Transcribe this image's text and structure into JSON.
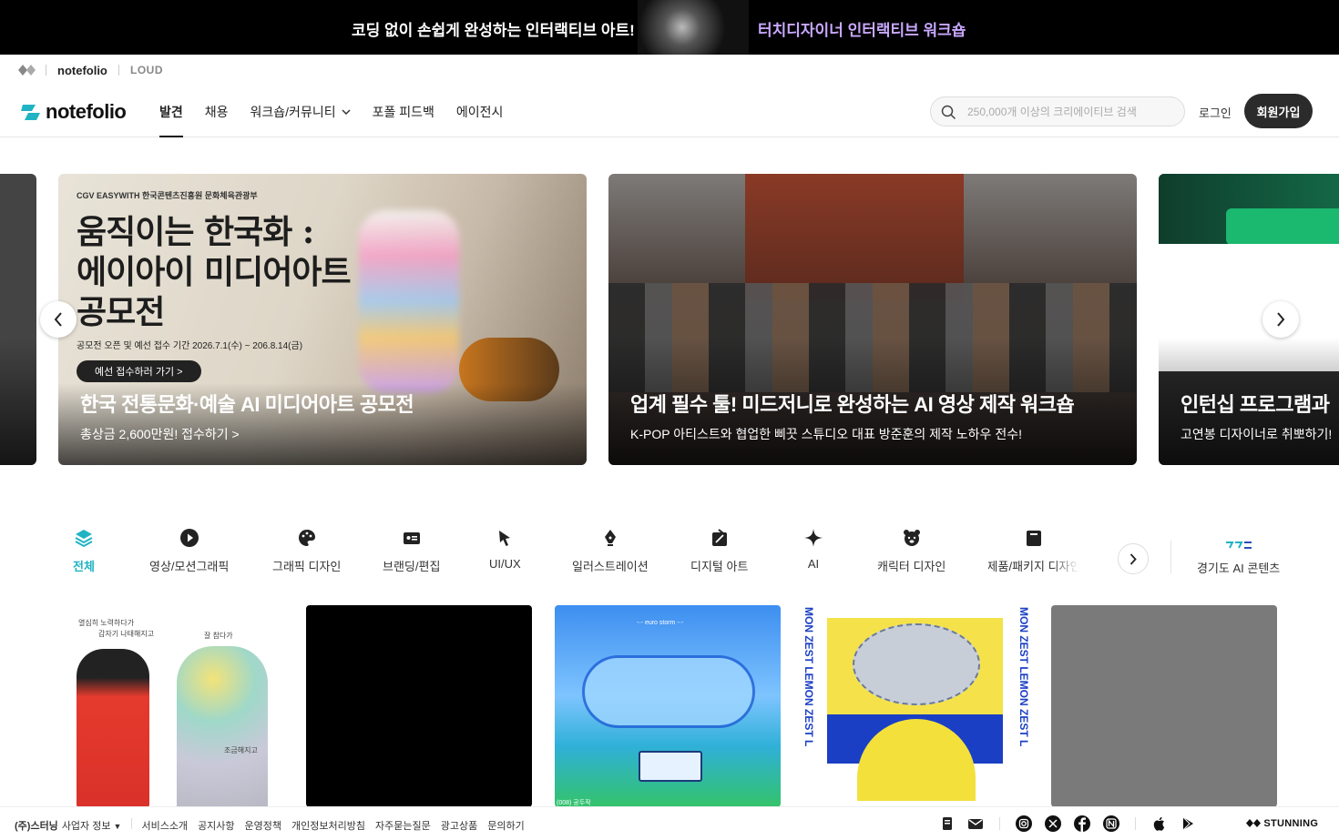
{
  "banner": {
    "left_text": "코딩 없이 손쉽게 완성하는 인터랙티브 아트!",
    "right_text": "터치디자이너 인터랙티브 워크숍",
    "right_color": "#c9a8ff"
  },
  "subnav": {
    "notefolio": "notefolio",
    "loud": "LOUD"
  },
  "header": {
    "brand": "notefolio",
    "brand_color": "#1fb3c4",
    "nav": [
      "발견",
      "채용",
      "워크숍/커뮤니티",
      "포폴 피드백",
      "에이전시"
    ],
    "active_nav": "발견",
    "search_placeholder": "250,000개 이상의 크리에이티브 검색",
    "login": "로그인",
    "signup": "회원가입"
  },
  "carousel": {
    "slides": [
      {
        "poster_brand": "CGV  EASYWITH  한국콘텐츠진흥원  문화체육관광부",
        "poster_title_1": "움직이는 한국화 :",
        "poster_title_2": "에이아이 미디어아트",
        "poster_title_3": "공모전",
        "poster_period": "공모전 오픈 및 예선 접수 기간   2026.7.1(수) ~ 206.8.14(금)",
        "poster_cta": "예선 접수하러 가기 >",
        "title": "한국 전통문화·예술 AI 미디어아트 공모전",
        "subtitle": "총상금 2,600만원! 접수하기 >"
      },
      {
        "title": "업계 필수 툴! 미드저니로 완성하는 AI 영상 제작 워크숍",
        "subtitle": "K-POP 아티스트와 협업한 삐끗 스튜디오 대표 방준훈의 제작 노하우 전수!"
      },
      {
        "title": "인턴십 프로그램과",
        "subtitle": "고연봉 디자이너로 취뽀하기!"
      }
    ]
  },
  "categories": {
    "items": [
      {
        "label": "전체",
        "icon": "layers-icon"
      },
      {
        "label": "영상/모션그래픽",
        "icon": "play-circle-icon"
      },
      {
        "label": "그래픽 디자인",
        "icon": "palette-icon"
      },
      {
        "label": "브랜딩/편집",
        "icon": "id-card-icon"
      },
      {
        "label": "UI/UX",
        "icon": "cursor-icon"
      },
      {
        "label": "일러스트레이션",
        "icon": "pen-nib-icon"
      },
      {
        "label": "디지털 아트",
        "icon": "digital-art-icon"
      },
      {
        "label": "AI",
        "icon": "sparkle-icon"
      },
      {
        "label": "캐릭터 디자인",
        "icon": "bear-icon"
      },
      {
        "label": "제품/패키지 디자인",
        "icon": "package-icon"
      }
    ],
    "active": "전체",
    "active_color": "#1fb3c4",
    "special": "경기도 AI 콘텐츠"
  },
  "cards": {
    "card1_text_a": "열심히 노력하다가",
    "card1_text_b": "갑자기 나태해지고",
    "card1_text_c": "잘 참다가",
    "card1_text_d": "조금해지고",
    "card3_text_top": "-·- euro storm -·-",
    "card3_text_bottom": "(008)  공두작",
    "card4_vertical": "MON ZEST   LEMON ZEST   L"
  },
  "footer": {
    "company": "(주)스터닝",
    "business_info": "사업자 정보",
    "links": [
      "서비스소개",
      "공지사항",
      "운영정책",
      "개인정보처리방침",
      "자주묻는질문",
      "광고상품",
      "문의하기"
    ],
    "brand": "STUNNING"
  }
}
